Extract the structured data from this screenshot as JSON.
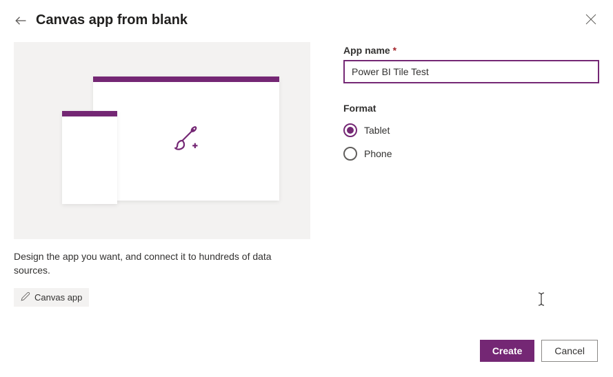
{
  "header": {
    "title": "Canvas app from blank"
  },
  "description": "Design the app you want, and connect it to hundreds of data sources.",
  "tag": {
    "label": "Canvas app"
  },
  "form": {
    "appName": {
      "label": "App name",
      "value": "Power BI Tile Test"
    },
    "format": {
      "label": "Format",
      "options": {
        "tablet": "Tablet",
        "phone": "Phone"
      }
    }
  },
  "footer": {
    "create": "Create",
    "cancel": "Cancel"
  }
}
